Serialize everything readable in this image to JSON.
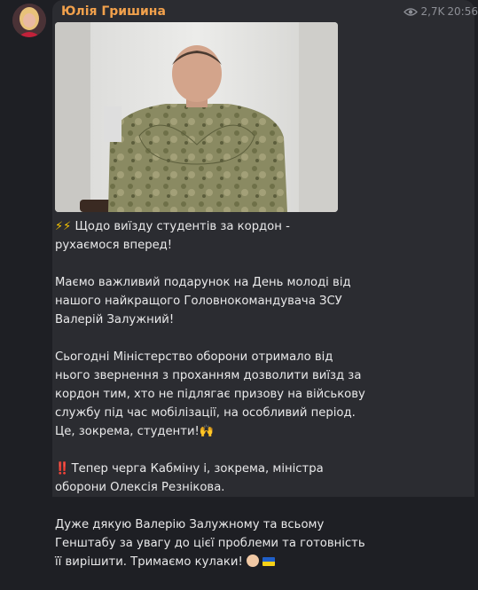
{
  "sender": {
    "name": "Юлія Гришина"
  },
  "meta": {
    "views": "2,7K",
    "time": "20:56"
  },
  "message": {
    "p1_icons": "⚡⚡",
    "p1_text": "Щодо виїзду студентів за кордон -\nрухаємося вперед!",
    "p2_text": "Маємо важливий подарунок на День молоді від\nнашого найкращого Головнокомандувача ЗСУ\nВалерій Залужний!",
    "p3_text": "Сьогодні Міністерство оборони отримало від\nнього звернення з проханням дозволити виїзд за\nкордон тим, хто не підлягає призову на військову\nслужбу під час мобілізації, на особливий період.\nЦе, зокрема, студенти!",
    "p3_emoji": "🙌",
    "p4_icon": "‼️",
    "p4_text": "Тепер черга  Кабміну і, зокрема, міністра\nоборони Олексія Резнікова.",
    "p5_text": "Дуже дякую Валерію Залужному та всьому\nГенштабу за увагу до цієї проблеми та готовність\nїї вирішити. Тримаємо кулаки!",
    "colors": {
      "flag_blue": "#1f5fc9",
      "flag_yellow": "#f7d117"
    }
  }
}
